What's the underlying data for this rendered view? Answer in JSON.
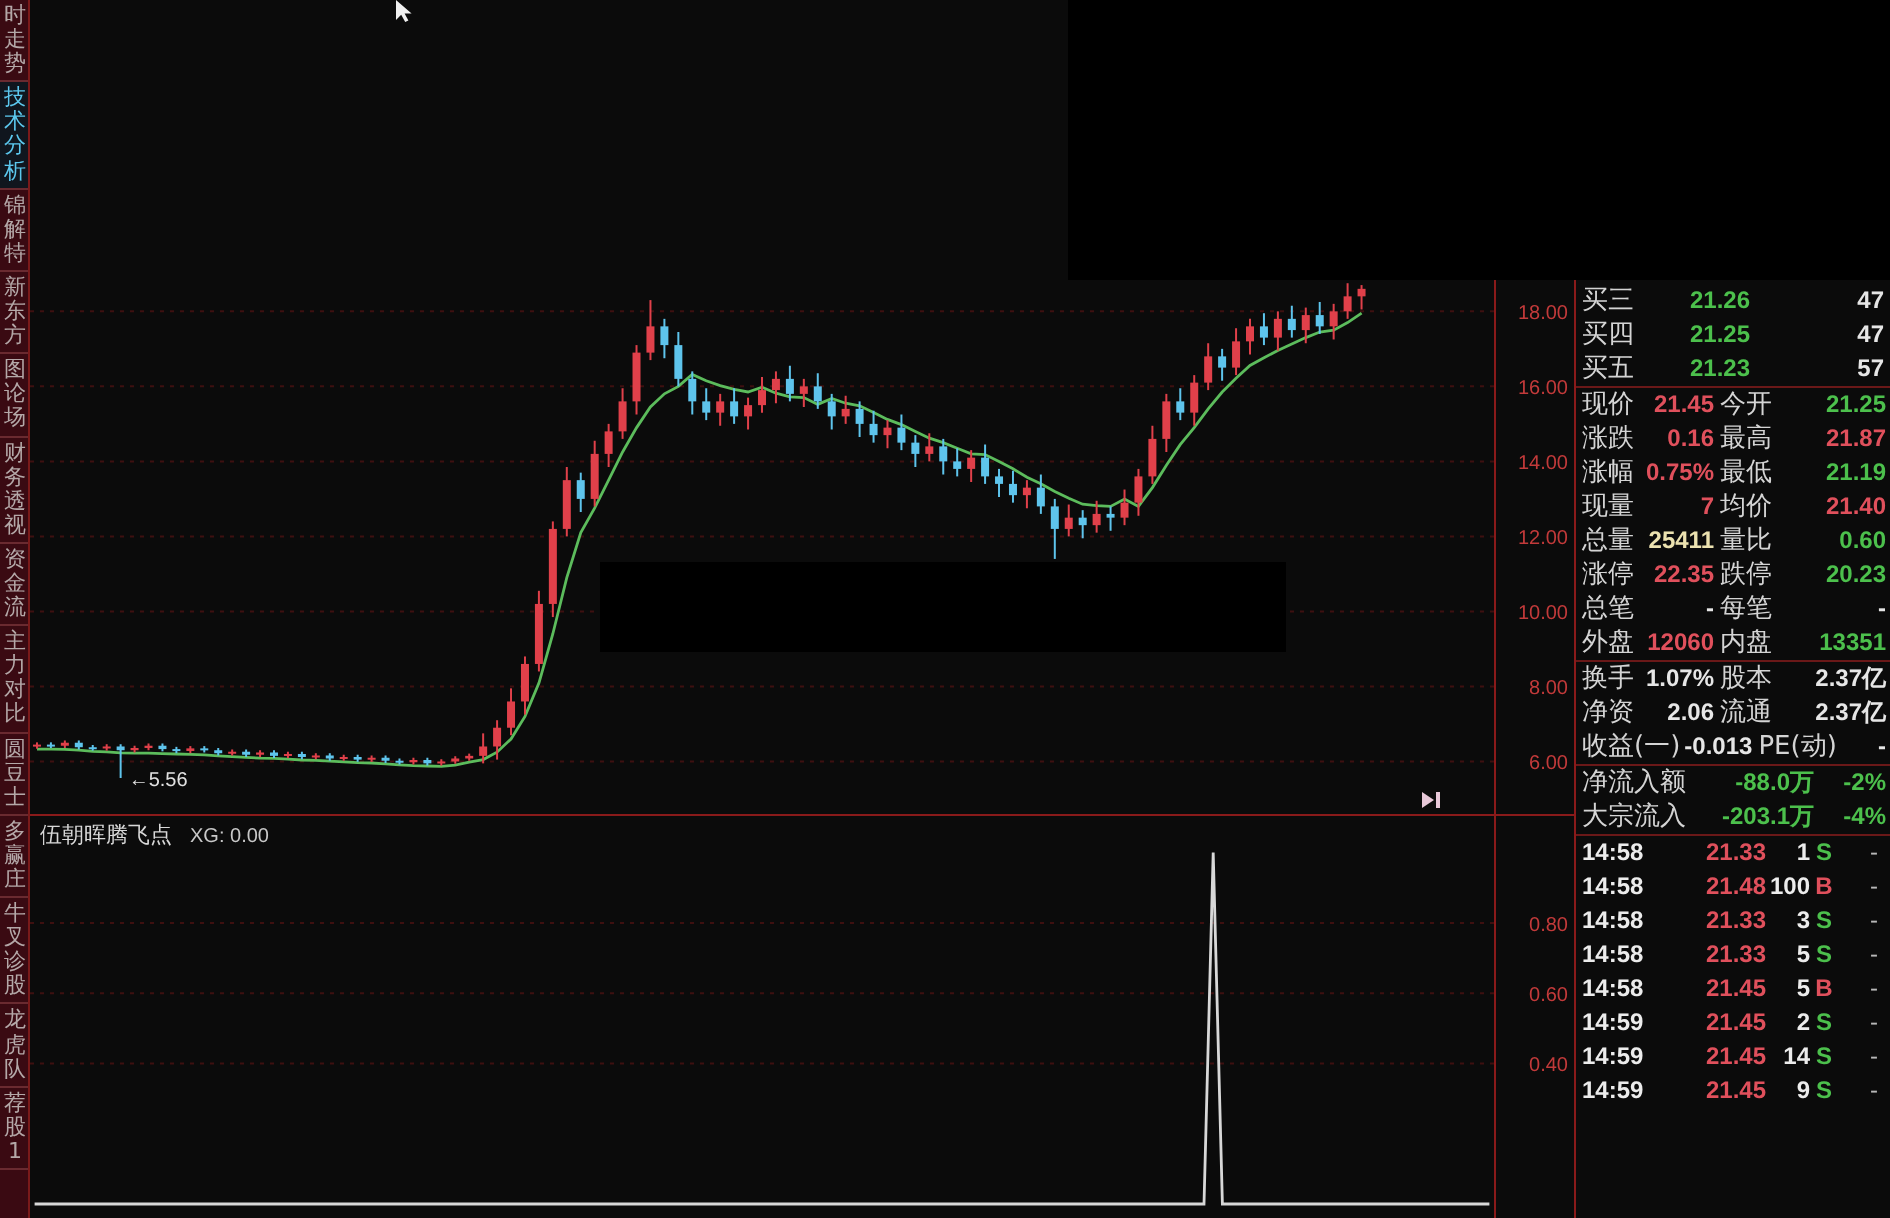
{
  "sidebar": {
    "tabs": [
      {
        "label": "时走势",
        "selected": false
      },
      {
        "label": "技术分析",
        "selected": true
      },
      {
        "label": "锦解特",
        "selected": false
      },
      {
        "label": "新东方",
        "selected": false
      },
      {
        "label": "图论场",
        "selected": false
      },
      {
        "label": "财务透视",
        "selected": false
      },
      {
        "label": "资金流",
        "selected": false
      },
      {
        "label": "主力对比",
        "selected": false
      },
      {
        "label": "圆豆士",
        "selected": false
      },
      {
        "label": "多赢庄",
        "selected": false
      },
      {
        "label": "牛叉诊股",
        "selected": false
      },
      {
        "label": "龙虎队",
        "selected": false
      },
      {
        "label": "荐股1",
        "selected": false
      }
    ]
  },
  "price_chart": {
    "low_marker": "←5.56",
    "chart_data": {
      "type": "candlestick",
      "categories": [
        null,
        null,
        null,
        null,
        null,
        null,
        null,
        null,
        null,
        null,
        null,
        null,
        null,
        null,
        null,
        null,
        null,
        null,
        null,
        null,
        null,
        null,
        null,
        null,
        null,
        null,
        null,
        null,
        null,
        null,
        null,
        null,
        null,
        null,
        null,
        null,
        null,
        null,
        null,
        null,
        null,
        null,
        null,
        null,
        null,
        null,
        null,
        null,
        null,
        null,
        null,
        null,
        null,
        null,
        null,
        null,
        null,
        null,
        null,
        null,
        null,
        null,
        null,
        null,
        null,
        null,
        null,
        null,
        null,
        null,
        null,
        null,
        null,
        null,
        null,
        null,
        null,
        null,
        null,
        null,
        null,
        null,
        null,
        null,
        null,
        null,
        null,
        null,
        null,
        null,
        null,
        null,
        null,
        null,
        null,
        null,
        null,
        null,
        null,
        null,
        null,
        null,
        null,
        null,
        null
      ],
      "ohlc": [
        [
          6.4,
          6.51,
          6.34,
          6.45
        ],
        [
          6.45,
          6.51,
          6.36,
          6.42
        ],
        [
          6.42,
          6.56,
          6.36,
          6.5
        ],
        [
          6.5,
          6.56,
          6.32,
          6.38
        ],
        [
          6.38,
          6.44,
          6.29,
          6.35
        ],
        [
          6.35,
          6.46,
          6.29,
          6.4
        ],
        [
          6.4,
          6.46,
          5.56,
          6.3
        ],
        [
          6.3,
          6.42,
          6.24,
          6.36
        ],
        [
          6.36,
          6.48,
          6.3,
          6.42
        ],
        [
          6.42,
          6.48,
          6.27,
          6.33
        ],
        [
          6.33,
          6.39,
          6.22,
          6.28
        ],
        [
          6.28,
          6.41,
          6.22,
          6.35
        ],
        [
          6.35,
          6.41,
          6.24,
          6.3
        ],
        [
          6.3,
          6.36,
          6.16,
          6.22
        ],
        [
          6.22,
          6.32,
          6.16,
          6.26
        ],
        [
          6.26,
          6.32,
          6.12,
          6.18
        ],
        [
          6.18,
          6.3,
          6.12,
          6.24
        ],
        [
          6.24,
          6.3,
          6.09,
          6.15
        ],
        [
          6.15,
          6.26,
          6.09,
          6.2
        ],
        [
          6.2,
          6.26,
          6.06,
          6.12
        ],
        [
          6.12,
          6.22,
          6.06,
          6.16
        ],
        [
          6.16,
          6.22,
          6.02,
          6.08
        ],
        [
          6.08,
          6.18,
          6.02,
          6.12
        ],
        [
          6.12,
          6.18,
          5.99,
          6.05
        ],
        [
          6.05,
          6.16,
          5.99,
          6.1
        ],
        [
          6.1,
          6.16,
          5.96,
          6.02
        ],
        [
          6.02,
          6.08,
          5.92,
          5.98
        ],
        [
          5.98,
          6.1,
          5.92,
          6.04
        ],
        [
          6.04,
          6.1,
          5.89,
          5.95
        ],
        [
          5.95,
          6.06,
          5.89,
          6.0
        ],
        [
          6.0,
          6.14,
          5.94,
          6.08
        ],
        [
          6.08,
          6.21,
          6.02,
          6.15
        ],
        [
          6.15,
          6.75,
          5.95,
          6.4
        ],
        [
          6.4,
          7.1,
          6.05,
          6.9
        ],
        [
          6.9,
          7.95,
          6.7,
          7.6
        ],
        [
          7.6,
          8.8,
          7.25,
          8.6
        ],
        [
          8.6,
          10.55,
          8.4,
          10.2
        ],
        [
          10.2,
          12.4,
          9.85,
          12.2
        ],
        [
          12.2,
          13.85,
          12.0,
          13.5
        ],
        [
          13.5,
          13.7,
          12.65,
          13.0
        ],
        [
          13.0,
          14.55,
          12.8,
          14.2
        ],
        [
          14.2,
          15.0,
          13.85,
          14.8
        ],
        [
          14.8,
          15.95,
          14.6,
          15.6
        ],
        [
          15.6,
          17.1,
          15.25,
          16.9
        ],
        [
          16.9,
          18.3,
          16.7,
          17.6
        ],
        [
          17.6,
          17.8,
          16.75,
          17.1
        ],
        [
          17.1,
          17.45,
          16.0,
          16.2
        ],
        [
          16.2,
          16.4,
          15.25,
          15.6
        ],
        [
          15.6,
          15.95,
          15.1,
          15.3
        ],
        [
          15.3,
          15.8,
          14.95,
          15.6
        ],
        [
          15.6,
          15.95,
          15.0,
          15.2
        ],
        [
          15.2,
          15.7,
          14.85,
          15.5
        ],
        [
          15.5,
          16.25,
          15.3,
          15.9
        ],
        [
          15.9,
          16.4,
          15.55,
          16.2
        ],
        [
          16.2,
          16.55,
          15.6,
          15.8
        ],
        [
          15.8,
          16.2,
          15.45,
          16.0
        ],
        [
          16.0,
          16.35,
          15.4,
          15.6
        ],
        [
          15.6,
          15.8,
          14.85,
          15.2
        ],
        [
          15.2,
          15.75,
          15.0,
          15.4
        ],
        [
          15.4,
          15.6,
          14.65,
          15.0
        ],
        [
          15.0,
          15.35,
          14.5,
          14.7
        ],
        [
          14.7,
          15.1,
          14.35,
          14.9
        ],
        [
          14.9,
          15.25,
          14.3,
          14.5
        ],
        [
          14.5,
          14.7,
          13.85,
          14.2
        ],
        [
          14.2,
          14.75,
          14.0,
          14.4
        ],
        [
          14.4,
          14.6,
          13.65,
          14.0
        ],
        [
          14.0,
          14.35,
          13.6,
          13.8
        ],
        [
          13.8,
          14.3,
          13.45,
          14.1
        ],
        [
          14.1,
          14.45,
          13.4,
          13.6
        ],
        [
          13.6,
          13.8,
          13.05,
          13.4
        ],
        [
          13.4,
          13.75,
          12.9,
          13.1
        ],
        [
          13.1,
          13.5,
          12.75,
          13.3
        ],
        [
          13.3,
          13.65,
          12.6,
          12.8
        ],
        [
          12.8,
          13.0,
          11.4,
          12.2
        ],
        [
          12.2,
          12.85,
          12.0,
          12.5
        ],
        [
          12.5,
          12.7,
          11.95,
          12.3
        ],
        [
          12.3,
          12.95,
          12.1,
          12.6
        ],
        [
          12.6,
          12.8,
          12.15,
          12.5
        ],
        [
          12.5,
          13.25,
          12.3,
          12.9
        ],
        [
          12.9,
          13.8,
          12.55,
          13.6
        ],
        [
          13.6,
          14.95,
          13.4,
          14.6
        ],
        [
          14.6,
          15.8,
          14.25,
          15.6
        ],
        [
          15.6,
          15.95,
          15.1,
          15.3
        ],
        [
          15.3,
          16.3,
          14.95,
          16.1
        ],
        [
          16.1,
          17.15,
          15.9,
          16.8
        ],
        [
          16.8,
          17.0,
          16.15,
          16.5
        ],
        [
          16.5,
          17.55,
          16.3,
          17.2
        ],
        [
          17.2,
          17.8,
          16.85,
          17.6
        ],
        [
          17.6,
          17.95,
          17.1,
          17.3
        ],
        [
          17.3,
          18.0,
          16.95,
          17.8
        ],
        [
          17.8,
          18.15,
          17.3,
          17.5
        ],
        [
          17.5,
          18.1,
          17.15,
          17.9
        ],
        [
          17.9,
          18.25,
          17.4,
          17.6
        ],
        [
          17.6,
          18.2,
          17.25,
          18.0
        ],
        [
          18.0,
          18.75,
          17.8,
          18.4
        ],
        [
          18.4,
          18.7,
          18.05,
          18.6
        ],
        null,
        null,
        null,
        null,
        null,
        null,
        null,
        null,
        null
      ],
      "series": [
        {
          "type": "line",
          "color": "#5cbc5c",
          "values": [
            6.33,
            6.33,
            6.32,
            6.3,
            6.27,
            6.26,
            6.23,
            6.22,
            6.22,
            6.21,
            6.2,
            6.19,
            6.18,
            6.15,
            6.13,
            6.11,
            6.09,
            6.08,
            6.06,
            6.04,
            6.03,
            6.01,
            5.99,
            5.97,
            5.96,
            5.94,
            5.91,
            5.89,
            5.88,
            5.87,
            5.9,
            5.98,
            6.05,
            6.25,
            6.6,
            7.2,
            8.1,
            9.4,
            10.9,
            12.1,
            12.75,
            13.5,
            14.25,
            14.9,
            15.45,
            15.8,
            16.0,
            16.32,
            16.15,
            16.02,
            15.92,
            15.85,
            15.98,
            15.82,
            15.72,
            15.7,
            15.52,
            15.68,
            15.55,
            15.48,
            15.3,
            15.12,
            14.98,
            14.8,
            14.62,
            14.5,
            14.35,
            14.2,
            14.18,
            14.0,
            13.8,
            13.58,
            13.4,
            13.2,
            13.02,
            12.86,
            12.82,
            12.8,
            13.0,
            12.8,
            13.3,
            13.9,
            14.45,
            14.9,
            15.4,
            15.85,
            16.22,
            16.56,
            16.76,
            16.96,
            17.13,
            17.3,
            17.45,
            17.5,
            17.7,
            17.95,
            null,
            null,
            null,
            null,
            null,
            null,
            null,
            null,
            null
          ]
        }
      ],
      "ylim": [
        4.6,
        26.3
      ],
      "grid": true,
      "yticks": [
        {
          "value": 18,
          "label": "18.00"
        },
        {
          "value": 16,
          "label": "16.00"
        },
        {
          "value": 14,
          "label": "14.00"
        },
        {
          "value": 12,
          "label": "12.00"
        },
        {
          "value": 10,
          "label": "10.00"
        },
        {
          "value": 8,
          "label": "8.00"
        },
        {
          "value": 6,
          "label": "6.00"
        }
      ]
    }
  },
  "indicator": {
    "name": "伍朝晖腾飞点",
    "reading": ": 0.00",
    "chart_data": {
      "type": "line",
      "categories": [
        null,
        null,
        null,
        null,
        null,
        null,
        null,
        null,
        null,
        null,
        null,
        null,
        null,
        null,
        null,
        null,
        null,
        null,
        null,
        null,
        null,
        null,
        null,
        null,
        null,
        null,
        null,
        null,
        null,
        null,
        null,
        null,
        null,
        null,
        null,
        null,
        null,
        null,
        null,
        null,
        null,
        null,
        null,
        null,
        null,
        null,
        null,
        null,
        null,
        null,
        null,
        null,
        null,
        null,
        null,
        null,
        null,
        null,
        null,
        null,
        null,
        null,
        null,
        null,
        null,
        null,
        null,
        null,
        null,
        null,
        null,
        null,
        null,
        null,
        null,
        null,
        null,
        null,
        null,
        null,
        null,
        null,
        null,
        null,
        null,
        null,
        null,
        null,
        null,
        null,
        null,
        null,
        null,
        null,
        null,
        null,
        null,
        null,
        null,
        null,
        null,
        null,
        null,
        null,
        null,
        null,
        null,
        null,
        null,
        null,
        null,
        null,
        null,
        null,
        null,
        null,
        null,
        null,
        null,
        null,
        null,
        null,
        null,
        null,
        null,
        null,
        null,
        null,
        null,
        null,
        null,
        null,
        null,
        null,
        null,
        null,
        null,
        null,
        null,
        null,
        null,
        null,
        null,
        null,
        null,
        null,
        null,
        null,
        null,
        null,
        null,
        null,
        null,
        null,
        null,
        null,
        null,
        null,
        null
      ],
      "series": [
        {
          "name": "XG",
          "color": "#d8d8d8",
          "values": [
            0,
            0,
            0,
            0,
            0,
            0,
            0,
            0,
            0,
            0,
            0,
            0,
            0,
            0,
            0,
            0,
            0,
            0,
            0,
            0,
            0,
            0,
            0,
            0,
            0,
            0,
            0,
            0,
            0,
            0,
            0,
            0,
            0,
            0,
            0,
            0,
            0,
            0,
            0,
            0,
            0,
            0,
            0,
            0,
            0,
            0,
            0,
            0,
            0,
            0,
            0,
            0,
            0,
            0,
            0,
            0,
            0,
            0,
            0,
            0,
            0,
            0,
            0,
            0,
            0,
            0,
            0,
            0,
            0,
            0,
            0,
            0,
            0,
            0,
            0,
            0,
            0,
            0,
            0,
            0,
            0,
            0,
            0,
            0,
            0,
            0,
            0,
            0,
            0,
            0,
            0,
            0,
            0,
            0,
            0,
            0,
            0,
            0,
            0,
            0,
            0,
            0,
            0,
            0,
            0,
            0,
            0,
            0,
            0,
            0,
            0,
            0,
            0,
            0,
            0,
            0,
            0,
            0,
            0,
            0,
            0,
            0,
            0,
            0,
            0,
            0,
            0,
            0,
            1,
            0,
            0,
            0,
            0,
            0,
            0,
            0,
            0,
            0,
            0,
            0,
            0,
            0,
            0,
            0,
            0,
            0,
            0,
            0,
            0,
            0,
            0,
            0,
            0,
            0,
            0,
            0,
            0,
            0,
            0
          ]
        }
      ],
      "ylim": [
        -0.04,
        1.11
      ],
      "grid": true,
      "yticks": [
        {
          "value": 0.8,
          "label": "0.80"
        },
        {
          "value": 0.6,
          "label": "0.60"
        },
        {
          "value": 0.4,
          "label": "0.40"
        }
      ]
    }
  },
  "quote_panel": {
    "order_book": [
      {
        "label": "买三",
        "price": {
          "text": "21.26",
          "color": "#4cc04c"
        },
        "volume": "47"
      },
      {
        "label": "买四",
        "price": {
          "text": "21.25",
          "color": "#4cc04c"
        },
        "volume": "47"
      },
      {
        "label": "买五",
        "price": {
          "text": "21.23",
          "color": "#4cc04c"
        },
        "volume": "57"
      }
    ],
    "quote_rows": [
      {
        "left": {
          "label": "现价",
          "value": "21.45",
          "color": "#e0505c"
        },
        "right": {
          "label": "今开",
          "value": "21.25",
          "color": "#4cc04c"
        }
      },
      {
        "left": {
          "label": "涨跌",
          "value": "0.16",
          "color": "#e0505c"
        },
        "right": {
          "label": "最高",
          "value": "21.87",
          "color": "#e0505c"
        }
      },
      {
        "left": {
          "label": "涨幅",
          "value": "0.75%",
          "color": "#e0505c"
        },
        "right": {
          "label": "最低",
          "value": "21.19",
          "color": "#4cc04c"
        }
      },
      {
        "left": {
          "label": "现量",
          "value": "7",
          "color": "#e0505c"
        },
        "right": {
          "label": "均价",
          "value": "21.40",
          "color": "#e0505c"
        }
      },
      {
        "left": {
          "label": "总量",
          "value": "25411",
          "color": "#ece2b0"
        },
        "right": {
          "label": "量比",
          "value": "0.60",
          "color": "#4cc04c"
        }
      },
      {
        "left": {
          "label": "涨停",
          "value": "22.35",
          "color": "#e0505c"
        },
        "right": {
          "label": "跌停",
          "value": "20.23",
          "color": "#4cc04c"
        }
      },
      {
        "left": {
          "label": "总笔",
          "value": "-",
          "color": "#e6e6e6"
        },
        "right": {
          "label": "每笔",
          "value": "-",
          "color": "#e6e6e6"
        }
      },
      {
        "left": {
          "label": "外盘",
          "value": "12060",
          "color": "#e0505c"
        },
        "right": {
          "label": "内盘",
          "value": "13351",
          "color": "#4cc04c"
        }
      }
    ],
    "fundamentals": [
      {
        "left": {
          "label": "换手",
          "value": "1.07%",
          "color": "#e6e6e6"
        },
        "right": {
          "label": "股本",
          "value": "2.37亿",
          "color": "#e6e6e6"
        }
      },
      {
        "left": {
          "label": "净资",
          "value": "2.06",
          "color": "#e6e6e6"
        },
        "right": {
          "label": "流通",
          "value": "2.37亿",
          "color": "#e6e6e6"
        }
      },
      {
        "left": {
          "label": "收益(一)",
          "value": "-0.013",
          "color": "#e6e6e6"
        },
        "right": {
          "label": "PE(动)",
          "value": "-",
          "color": "#e6e6e6"
        }
      }
    ],
    "fund_flows": [
      {
        "label": "净流入额",
        "value": "-88.0万",
        "percent": "-2%",
        "color": "#4cc04c"
      },
      {
        "label": "大宗流入",
        "value": "-203.1万",
        "percent": "-4%",
        "color": "#4cc04c"
      }
    ],
    "trades": [
      {
        "time": "14:58",
        "price": {
          "text": "21.33",
          "color": "#e0505c"
        },
        "volume": "1",
        "side": {
          "text": "S",
          "color": "#4cc04c"
        },
        "column_5": "-"
      },
      {
        "time": "14:58",
        "price": {
          "text": "21.48",
          "color": "#e0505c"
        },
        "volume": "100",
        "side": {
          "text": "B",
          "color": "#e0505c"
        },
        "column_5": "-"
      },
      {
        "time": "14:58",
        "price": {
          "text": "21.33",
          "color": "#e0505c"
        },
        "volume": "3",
        "side": {
          "text": "S",
          "color": "#4cc04c"
        },
        "column_5": "-"
      },
      {
        "time": "14:58",
        "price": {
          "text": "21.33",
          "color": "#e0505c"
        },
        "volume": "5",
        "side": {
          "text": "S",
          "color": "#4cc04c"
        },
        "column_5": "-"
      },
      {
        "time": "14:58",
        "price": {
          "text": "21.45",
          "color": "#e0505c"
        },
        "volume": "5",
        "side": {
          "text": "B",
          "color": "#e0505c"
        },
        "column_5": "-"
      },
      {
        "time": "14:59",
        "price": {
          "text": "21.45",
          "color": "#e0505c"
        },
        "volume": "2",
        "side": {
          "text": "S",
          "color": "#4cc04c"
        },
        "column_5": "-"
      },
      {
        "time": "14:59",
        "price": {
          "text": "21.45",
          "color": "#e0505c"
        },
        "volume": "14",
        "side": {
          "text": "S",
          "color": "#4cc04c"
        },
        "column_5": "-"
      },
      {
        "time": "14:59",
        "price": {
          "text": "21.45",
          "color": "#e0505c"
        },
        "volume": "9",
        "side": {
          "text": "S",
          "color": "#4cc04c"
        },
        "column_5": "-"
      }
    ]
  }
}
